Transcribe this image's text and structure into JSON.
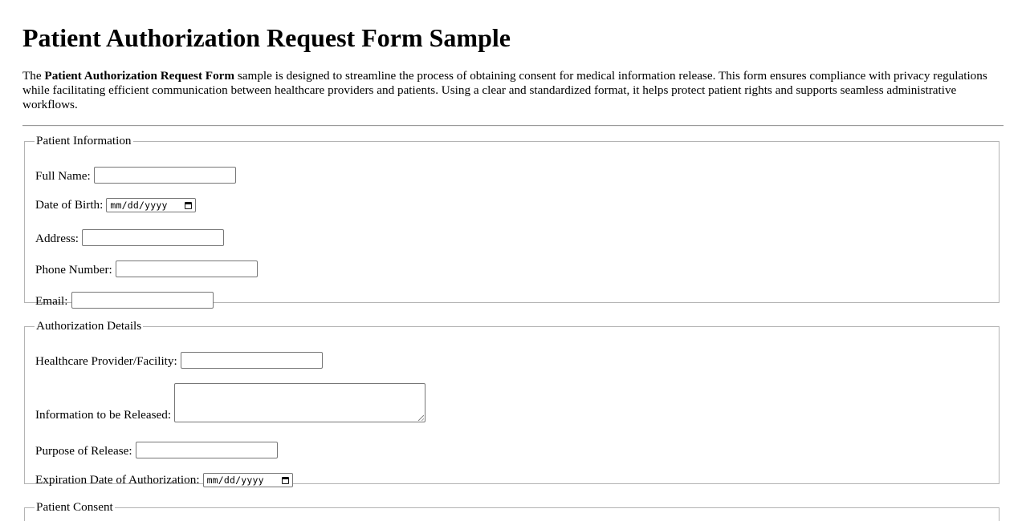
{
  "page": {
    "title": "Patient Authorization Request Form Sample",
    "intro": {
      "prefix": "The ",
      "bold": "Patient Authorization Request Form",
      "suffix": " sample is designed to streamline the process of obtaining consent for medical information release. This form ensures compliance with privacy regulations while facilitating efficient communication between healthcare providers and patients. Using a clear and standardized format, it helps protect patient rights and supports seamless administrative workflows."
    }
  },
  "patient_info": {
    "legend": "Patient Information",
    "full_name_label": "Full Name:",
    "full_name_value": "",
    "dob_label": "Date of Birth:",
    "dob_placeholder": "mm/dd/yyyy",
    "address_label": "Address:",
    "address_value": "",
    "phone_label": "Phone Number:",
    "phone_value": "",
    "email_label": "Email:",
    "email_value": ""
  },
  "authorization": {
    "legend": "Authorization Details",
    "provider_label": "Healthcare Provider/Facility:",
    "provider_value": "",
    "info_label": "Information to be Released:",
    "info_value": "",
    "purpose_label": "Purpose of Release:",
    "purpose_value": "",
    "expiration_label": "Expiration Date of Authorization:",
    "expiration_placeholder": "mm/dd/yyyy"
  },
  "consent": {
    "legend": "Patient Consent"
  },
  "icons": {
    "date_picker": "calendar-icon",
    "textarea_resize": "resize-grip-icon"
  }
}
